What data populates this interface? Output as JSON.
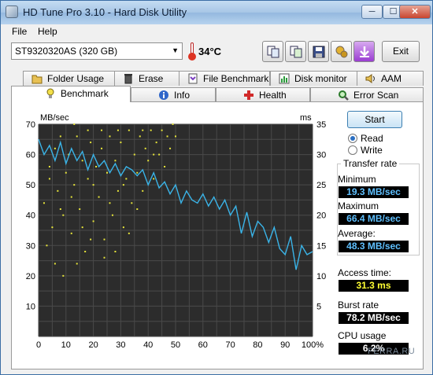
{
  "window": {
    "title": "HD Tune Pro 3.10 - Hard Disk Utility",
    "minimize": "─",
    "maximize": "☐",
    "close": "✕"
  },
  "menu": [
    "File",
    "Help"
  ],
  "toolbar": {
    "drive": "ST9320320AS (320 GB)",
    "temperature": "34°C",
    "buttons": [
      "copy-info-icon",
      "copy-text-icon",
      "save-icon",
      "options-icon",
      "download-icon"
    ],
    "exit_label": "Exit"
  },
  "tabs_top": [
    "Folder Usage",
    "Erase",
    "File Benchmark",
    "Disk monitor",
    "AAM"
  ],
  "tabs_bottom": [
    "Benchmark",
    "Info",
    "Health",
    "Error Scan"
  ],
  "benchmark": {
    "start_label": "Start",
    "read_label": "Read",
    "write_label": "Write",
    "read_selected": true,
    "transfer_rate_title": "Transfer rate",
    "minimum_label": "Minimum",
    "minimum_value": "19.3 MB/sec",
    "maximum_label": "Maximum",
    "maximum_value": "66.4 MB/sec",
    "average_label": "Average:",
    "average_value": "48.3 MB/sec",
    "access_time_label": "Access time:",
    "access_time_value": "31.3 ms",
    "burst_rate_label": "Burst rate",
    "burst_rate_value": "78.2 MB/sec",
    "cpu_usage_label": "CPU usage",
    "cpu_usage_value": "6.2%"
  },
  "watermark": "FERRA.RU",
  "chart_data": {
    "type": "line",
    "left_axis_unit": "MB/sec",
    "right_axis_unit": "ms",
    "y_ticks": [
      10,
      20,
      30,
      40,
      50,
      60,
      70
    ],
    "y2_ticks": [
      5,
      10,
      15,
      20,
      25,
      30,
      35
    ],
    "x_ticks": [
      "0",
      "10",
      "20",
      "30",
      "40",
      "50",
      "60",
      "70",
      "80",
      "90",
      "100%"
    ],
    "ylim": [
      0,
      70
    ],
    "y2lim": [
      0,
      35
    ],
    "xlim": [
      0,
      100
    ],
    "grid": true,
    "series": [
      {
        "color": "#3ab4e8",
        "x": [
          0,
          2,
          4,
          6,
          8,
          10,
          12,
          14,
          16,
          18,
          20,
          22,
          24,
          26,
          28,
          30,
          32,
          34,
          36,
          38,
          40,
          42,
          44,
          46,
          48,
          50,
          52,
          54,
          56,
          58,
          60,
          62,
          64,
          66,
          68,
          70,
          72,
          74,
          76,
          78,
          80,
          82,
          84,
          86,
          88,
          90,
          92,
          94,
          96,
          98,
          100
        ],
        "y": [
          65,
          60,
          63,
          58,
          64,
          57,
          62,
          58,
          61,
          55,
          60,
          56,
          58,
          54,
          57,
          53,
          56,
          55,
          53,
          55,
          50,
          54,
          49,
          51,
          47,
          50,
          44,
          48,
          45,
          44,
          47,
          43,
          46,
          42,
          45,
          40,
          43,
          34,
          41,
          33,
          38,
          36,
          31,
          36,
          29,
          27,
          33,
          22,
          30,
          27,
          28
        ]
      }
    ],
    "access_points": [
      [
        2,
        22
      ],
      [
        3,
        15
      ],
      [
        4,
        28
      ],
      [
        5,
        18
      ],
      [
        6,
        31
      ],
      [
        7,
        24
      ],
      [
        8,
        33
      ],
      [
        9,
        20
      ],
      [
        10,
        27
      ],
      [
        11,
        30
      ],
      [
        12,
        17
      ],
      [
        13,
        25
      ],
      [
        14,
        33
      ],
      [
        15,
        21
      ],
      [
        16,
        29
      ],
      [
        17,
        14
      ],
      [
        18,
        26
      ],
      [
        19,
        32
      ],
      [
        20,
        19
      ],
      [
        21,
        28
      ],
      [
        22,
        23
      ],
      [
        23,
        31
      ],
      [
        24,
        16
      ],
      [
        25,
        27
      ],
      [
        26,
        33
      ],
      [
        27,
        20
      ],
      [
        28,
        29
      ],
      [
        29,
        24
      ],
      [
        30,
        32
      ],
      [
        31,
        18
      ],
      [
        32,
        26
      ],
      [
        33,
        34
      ],
      [
        34,
        22
      ],
      [
        35,
        30
      ],
      [
        36,
        27
      ],
      [
        37,
        33
      ],
      [
        38,
        24
      ],
      [
        39,
        31
      ],
      [
        40,
        29
      ],
      [
        41,
        34
      ],
      [
        42,
        26
      ],
      [
        43,
        32
      ],
      [
        44,
        30
      ],
      [
        45,
        34
      ],
      [
        46,
        28
      ],
      [
        47,
        33
      ],
      [
        48,
        31
      ],
      [
        49,
        35
      ],
      [
        50,
        33
      ],
      [
        6,
        12
      ],
      [
        9,
        10
      ],
      [
        14,
        12
      ],
      [
        19,
        16
      ],
      [
        24,
        13
      ],
      [
        28,
        14
      ],
      [
        33,
        17
      ],
      [
        4,
        26
      ],
      [
        8,
        21
      ],
      [
        12,
        23
      ],
      [
        16,
        18
      ],
      [
        20,
        25
      ],
      [
        26,
        22
      ],
      [
        31,
        25
      ],
      [
        36,
        21
      ],
      [
        38,
        34
      ],
      [
        42,
        30
      ],
      [
        13,
        35
      ],
      [
        18,
        34
      ],
      [
        23,
        34
      ],
      [
        29,
        34
      ]
    ]
  }
}
